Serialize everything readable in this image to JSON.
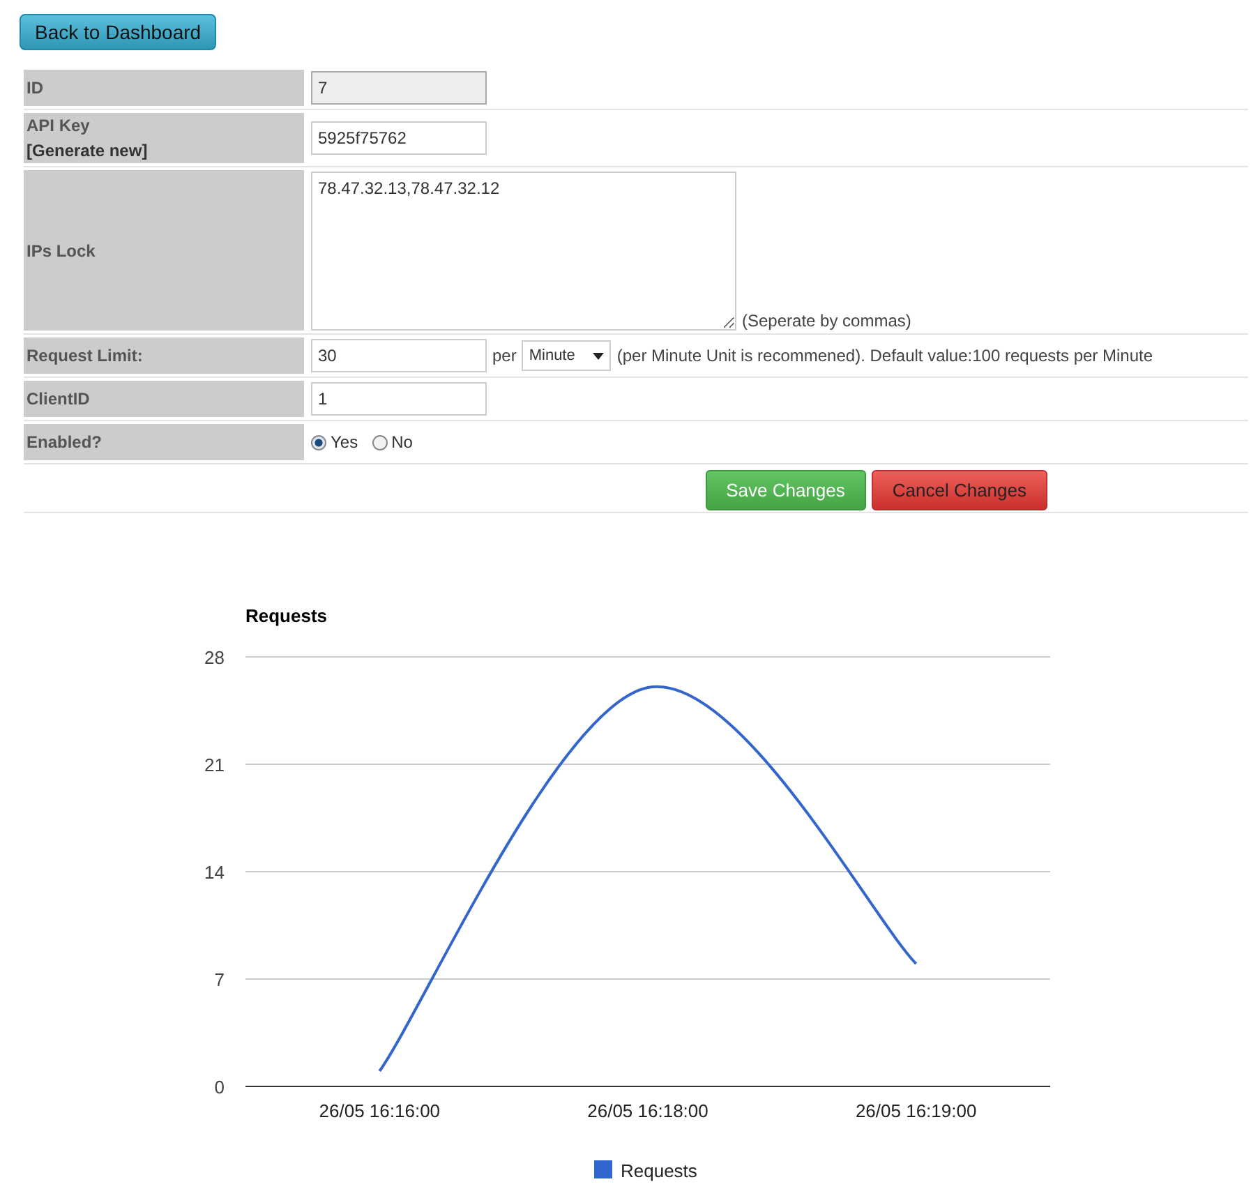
{
  "back_button": "Back to Dashboard",
  "fields": [
    {
      "kind": "text",
      "label": "ID",
      "value": "7",
      "disabled": true
    },
    {
      "kind": "apikey",
      "label": "API Key",
      "link": "[Generate new]",
      "value": "5925f75762",
      "disabled": false
    },
    {
      "kind": "textarea",
      "label": "IPs Lock",
      "value": "78.47.32.13,78.47.32.12",
      "hint": "(Seperate by commas)"
    },
    {
      "kind": "limit",
      "label": "Request Limit:",
      "value": "30",
      "per": "per",
      "unit": "Minute",
      "hint": "(per Minute Unit is recommened). Default value:100 requests per Minute"
    },
    {
      "kind": "text",
      "label": "ClientID",
      "value": "1",
      "disabled": false
    },
    {
      "kind": "radio",
      "label": "Enabled?",
      "options": [
        {
          "label": "Yes",
          "selected": true
        },
        {
          "label": "No",
          "selected": false
        }
      ]
    }
  ],
  "actions": [
    {
      "label": "Save Changes",
      "kind": "save"
    },
    {
      "label": "Cancel Changes",
      "kind": "cancel"
    }
  ],
  "chart": {
    "chart_data": {
      "type": "line",
      "title": "Requests",
      "categories": [
        "26/05 16:16:00",
        "26/05 16:18:00",
        "26/05 16:19:00"
      ],
      "series": [
        {
          "name": "Requests",
          "color": "#3366cc",
          "values": [
            1,
            26,
            8
          ]
        }
      ],
      "grid": true,
      "ylim": [
        0,
        28
      ],
      "yticks": [
        0,
        7,
        14,
        21,
        28
      ]
    }
  }
}
